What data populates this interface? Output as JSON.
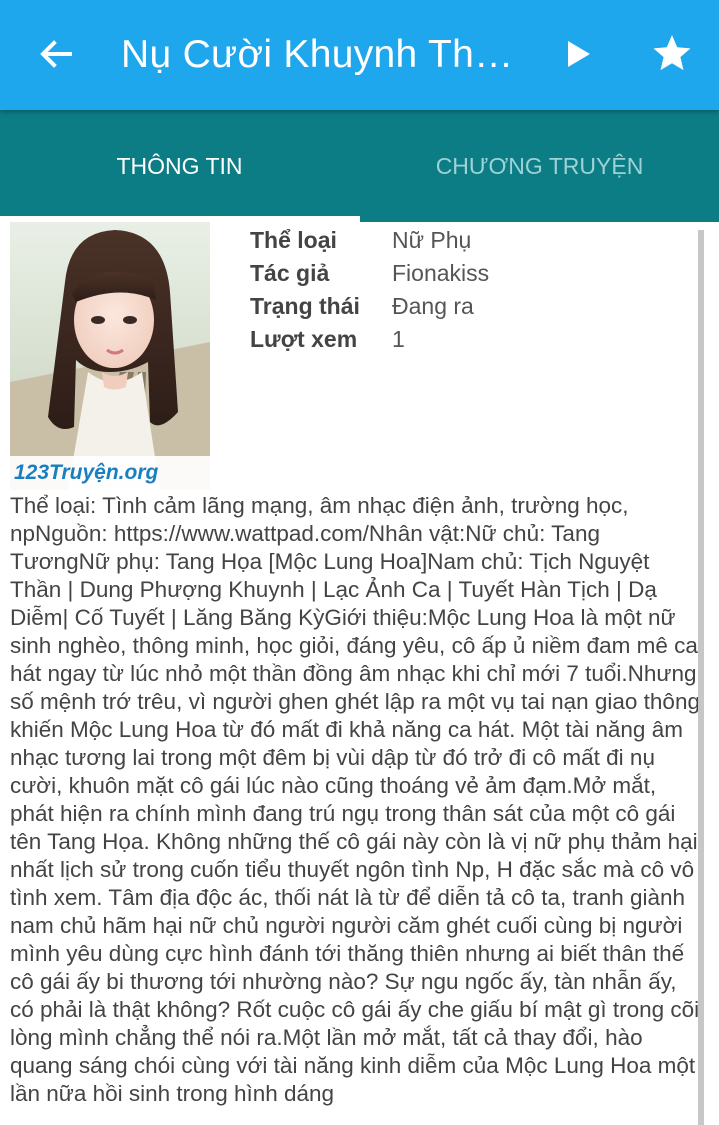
{
  "appbar": {
    "title": "Nụ Cười Khuynh Thành",
    "back_icon": "arrow-left-icon",
    "play_icon": "play-icon",
    "star_icon": "star-icon"
  },
  "tabs": [
    {
      "label": "THÔNG TIN",
      "active": true
    },
    {
      "label": "CHƯƠNG TRUYỆN",
      "active": false
    }
  ],
  "book": {
    "cover_watermark": "123Truyện.org",
    "meta": [
      {
        "key": "Thể loại",
        "value": "Nữ Phụ"
      },
      {
        "key": "Tác giả",
        "value": "Fionakiss"
      },
      {
        "key": "Trạng thái",
        "value": "Đang ra"
      },
      {
        "key": "Lượt xem",
        "value": "1"
      }
    ],
    "description": "Thể loại: Tình cảm lãng mạng, âm nhạc điện ảnh, trường học, npNguồn: https://www.wattpad.com/Nhân vật:Nữ chủ: Tang TươngNữ phụ: Tang Họa [Mộc Lung Hoa]Nam chủ: Tịch Nguyệt Thần | Dung Phượng Khuynh | Lạc Ảnh Ca | Tuyết Hàn Tịch | Dạ Diễm| Cố Tuyết | Lăng Băng KỳGiới thiệu:Mộc Lung Hoa là một nữ sinh nghèo, thông minh, học giỏi, đáng yêu, cô ấp ủ niềm đam mê ca hát ngay từ lúc nhỏ một thần đồng âm nhạc khi chỉ mới 7 tuổi.Nhưng số mệnh trớ trêu, vì người ghen ghét lập ra một vụ tai nạn giao thông khiến Mộc Lung Hoa từ đó mất đi khả năng ca hát. Một tài năng âm nhạc tương lai trong một đêm bị vùi dập từ đó trở đi cô mất đi nụ cười, khuôn mặt cô gái lúc nào cũng thoáng vẻ ảm đạm.Mở mắt, phát hiện ra chính mình đang trú ngụ trong thân sát của một cô gái tên Tang Họa. Không những thế cô gái này còn là vị nữ phụ thảm hại nhất lịch sử trong cuốn tiểu thuyết ngôn tình Np, H đặc sắc mà cô vô tình xem. Tâm địa độc ác, thối nát là từ để diễn tả cô ta, tranh giành nam chủ hãm hại nữ chủ người người căm ghét cuối cùng bị người mình yêu dùng cực hình đánh tới thăng thiên nhưng ai biết thân thế cô gái ấy bi thương tới nhường nào? Sự ngu ngốc ấy, tàn nhẫn ấy, có phải là thật không? Rốt cuộc cô gái ấy che giấu bí mật gì trong cõi lòng mình chẳng thể nói ra.Một lần mở mắt, tất cả thay đổi, hào quang sáng chói cùng với tài năng kinh diễm của Mộc Lung Hoa một lần nữa hồi sinh trong hình dáng"
  },
  "colors": {
    "appbar": "#1ea7ec",
    "tabbar": "#0c7c85",
    "tab_inactive_text": "#9dd2d6"
  }
}
